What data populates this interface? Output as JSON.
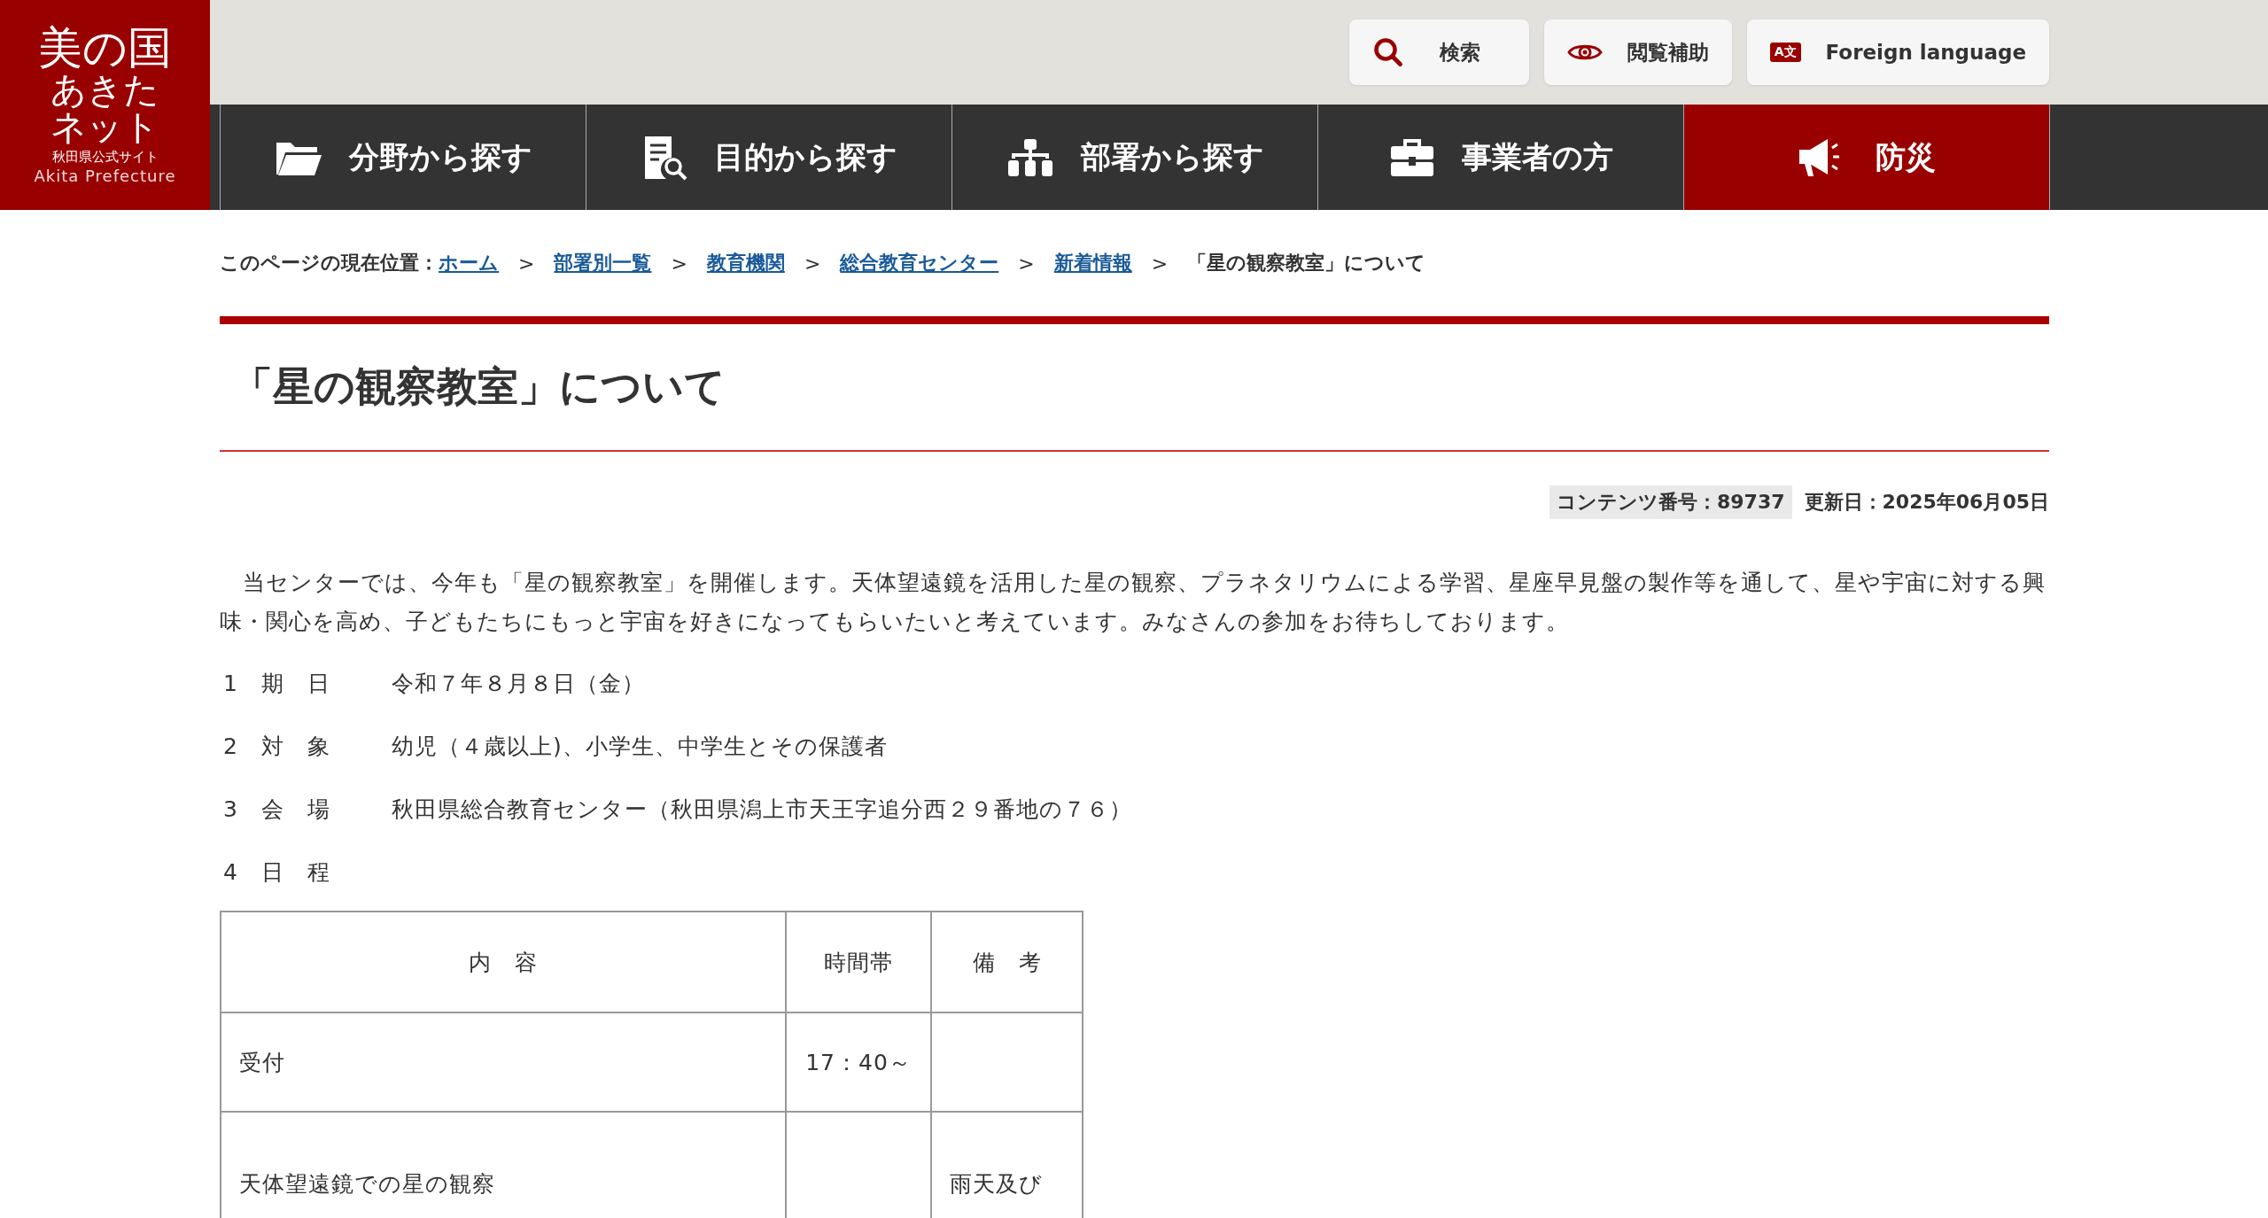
{
  "logo": {
    "lines": [
      "美の国",
      "あきた",
      "ネット"
    ],
    "subtitle": "秋田県公式サイト",
    "english": "Akita Prefecture"
  },
  "utility_buttons": [
    {
      "kind": "search",
      "label": "検索"
    },
    {
      "kind": "eye",
      "label": "閲覧補助"
    },
    {
      "kind": "language",
      "label": "Foreign language",
      "icon_text": "A文"
    }
  ],
  "nav": [
    {
      "kind": "folder",
      "label": "分野から探す",
      "selected": false
    },
    {
      "kind": "document",
      "label": "目的から探す",
      "selected": false
    },
    {
      "kind": "org",
      "label": "部署から探す",
      "selected": false
    },
    {
      "kind": "briefcase",
      "label": "事業者の方",
      "selected": false
    },
    {
      "kind": "megaphone",
      "label": "防災",
      "selected": true
    }
  ],
  "breadcrumb": {
    "prefix": "このページの現在位置：",
    "links": [
      "ホーム",
      "部署別一覧",
      "教育機関",
      "総合教育センター",
      "新着情報"
    ],
    "separator": ">",
    "current": "「星の観察教室」について"
  },
  "title": "「星の観察教室」について",
  "meta": {
    "content_number": "コンテンツ番号：89737",
    "updated": "更新日：2025年06月05日"
  },
  "intro": "　当センターでは、今年も「星の観察教室」を開催します。天体望遠鏡を活用した星の観察、プラネタリウムによる学習、星座早見盤の製作等を通して、星や宇宙に対する興味・関心を高め、子どもたちにもっと宇宙を好きになってもらいたいと考えています。みなさんの参加をお待ちしております。",
  "items": [
    {
      "label": "1　期　日",
      "value": "令和７年８月８日（金）"
    },
    {
      "label": "2　対　象",
      "value": "幼児（４歳以上)、小学生、中学生とその保護者"
    },
    {
      "label": "3　会　場",
      "value": "秋田県総合教育センター（秋田県潟上市天王字追分西２９番地の７６）"
    },
    {
      "label": "4　日　程"
    }
  ],
  "table": {
    "columns": [
      "内　容",
      "時間帯",
      "備　考"
    ],
    "rows": [
      [
        "受付",
        "17：40～",
        ""
      ],
      [
        "天体望遠鏡での星の観察",
        "",
        "雨天及び"
      ]
    ]
  }
}
